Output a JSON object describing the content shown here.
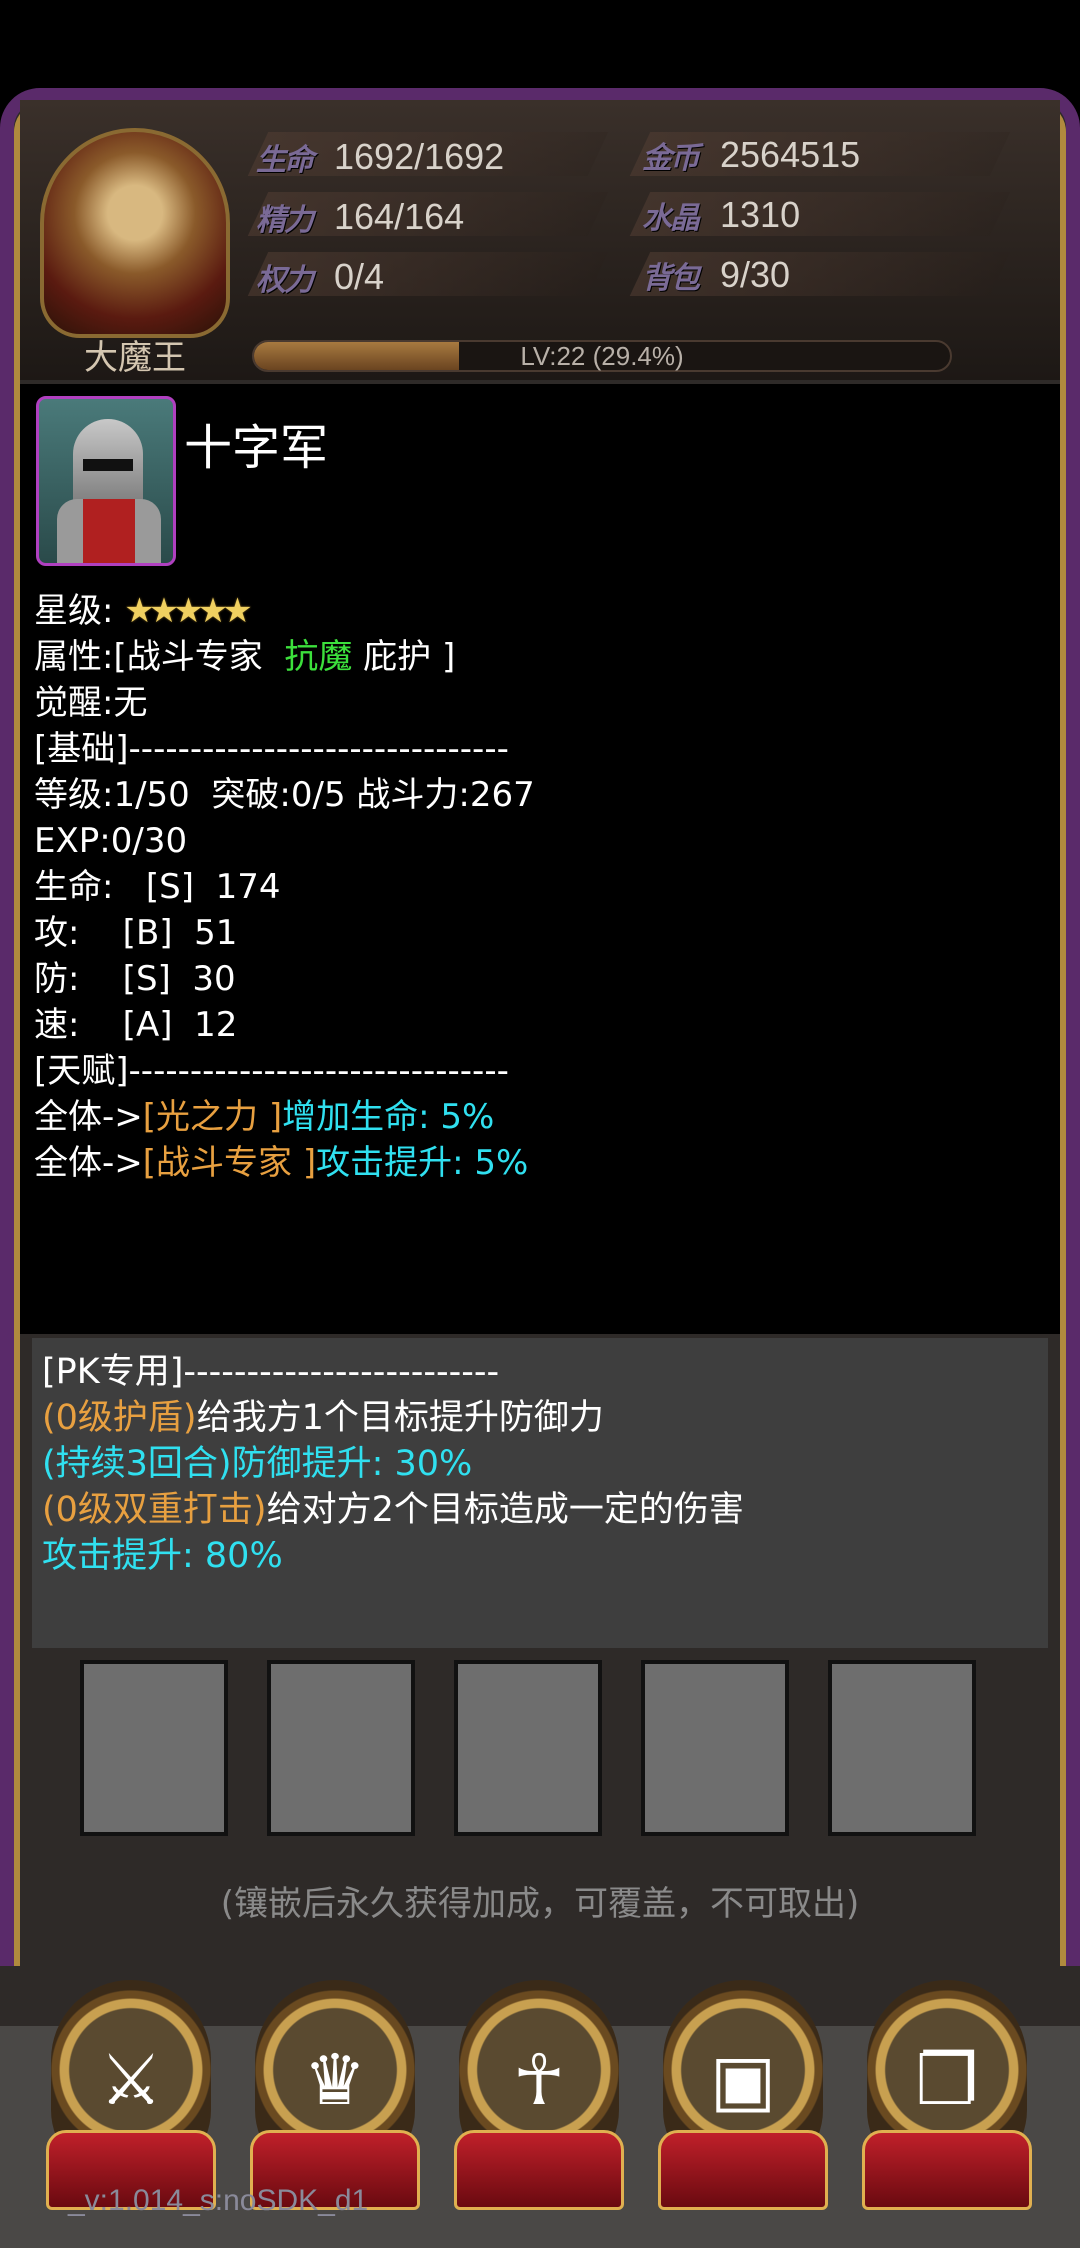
{
  "header": {
    "hero_name": "大魔王",
    "stats_left": [
      {
        "label": "生命",
        "value": "1692/1692"
      },
      {
        "label": "精力",
        "value": "164/164"
      },
      {
        "label": "权力",
        "value": "0/4"
      }
    ],
    "stats_right": [
      {
        "label": "金币",
        "value": "2564515"
      },
      {
        "label": "水晶",
        "value": "1310"
      },
      {
        "label": "背包",
        "value": "9/30"
      }
    ],
    "level_text": "LV:22 (29.4%)",
    "level_progress": 0.294
  },
  "unit": {
    "name": "十字军",
    "star_label": "星级:",
    "stars": 5,
    "attr_prefix": "属性:[战斗专家  ",
    "attr_green": "抗魔",
    "attr_suffix": " 庇护 ]",
    "awaken": "觉醒:无",
    "basic_header": "[基础]-------------------------------",
    "level_line": "等级:1/50  突破:0/5 战斗力:267",
    "exp_line": "EXP:0/30",
    "hp_line": "生命:   [S]  174",
    "atk_line": "攻:    [B]  51",
    "def_line": "防:    [S]  30",
    "spd_line": "速:    [A]  12",
    "talent_header": "[天赋]-------------------------------",
    "talents": [
      {
        "prefix": "全体->",
        "tag": "[光之力 ]",
        "effect": "增加生命: 5%"
      },
      {
        "prefix": "全体->",
        "tag": "[战斗专家 ]",
        "effect": "攻击提升: 5%"
      }
    ]
  },
  "pk": {
    "header": "[PK专用]-------------------------",
    "skill1_tag": "(0级护盾)",
    "skill1_desc": "给我方1个目标提升防御力",
    "skill1_effect": "(持续3回合)防御提升: 30%",
    "skill2_tag": "(0级双重打击)",
    "skill2_desc": "给对方2个目标造成一定的伤害",
    "skill2_effect": "攻击提升: 80%"
  },
  "gem_note": "(镶嵌后永久获得加成，可覆盖，不可取出)",
  "nav": [
    {
      "icon": "shield-swords-icon"
    },
    {
      "icon": "golden-helmet-icon"
    },
    {
      "icon": "priest-icon"
    },
    {
      "icon": "treasure-chest-icon"
    },
    {
      "icon": "book-icon"
    }
  ],
  "version": "_v:1.014_s:noSDK_d1",
  "colors": {
    "green": "#3ce03c",
    "orange": "#e8a040",
    "cyan": "#30e0f0"
  }
}
